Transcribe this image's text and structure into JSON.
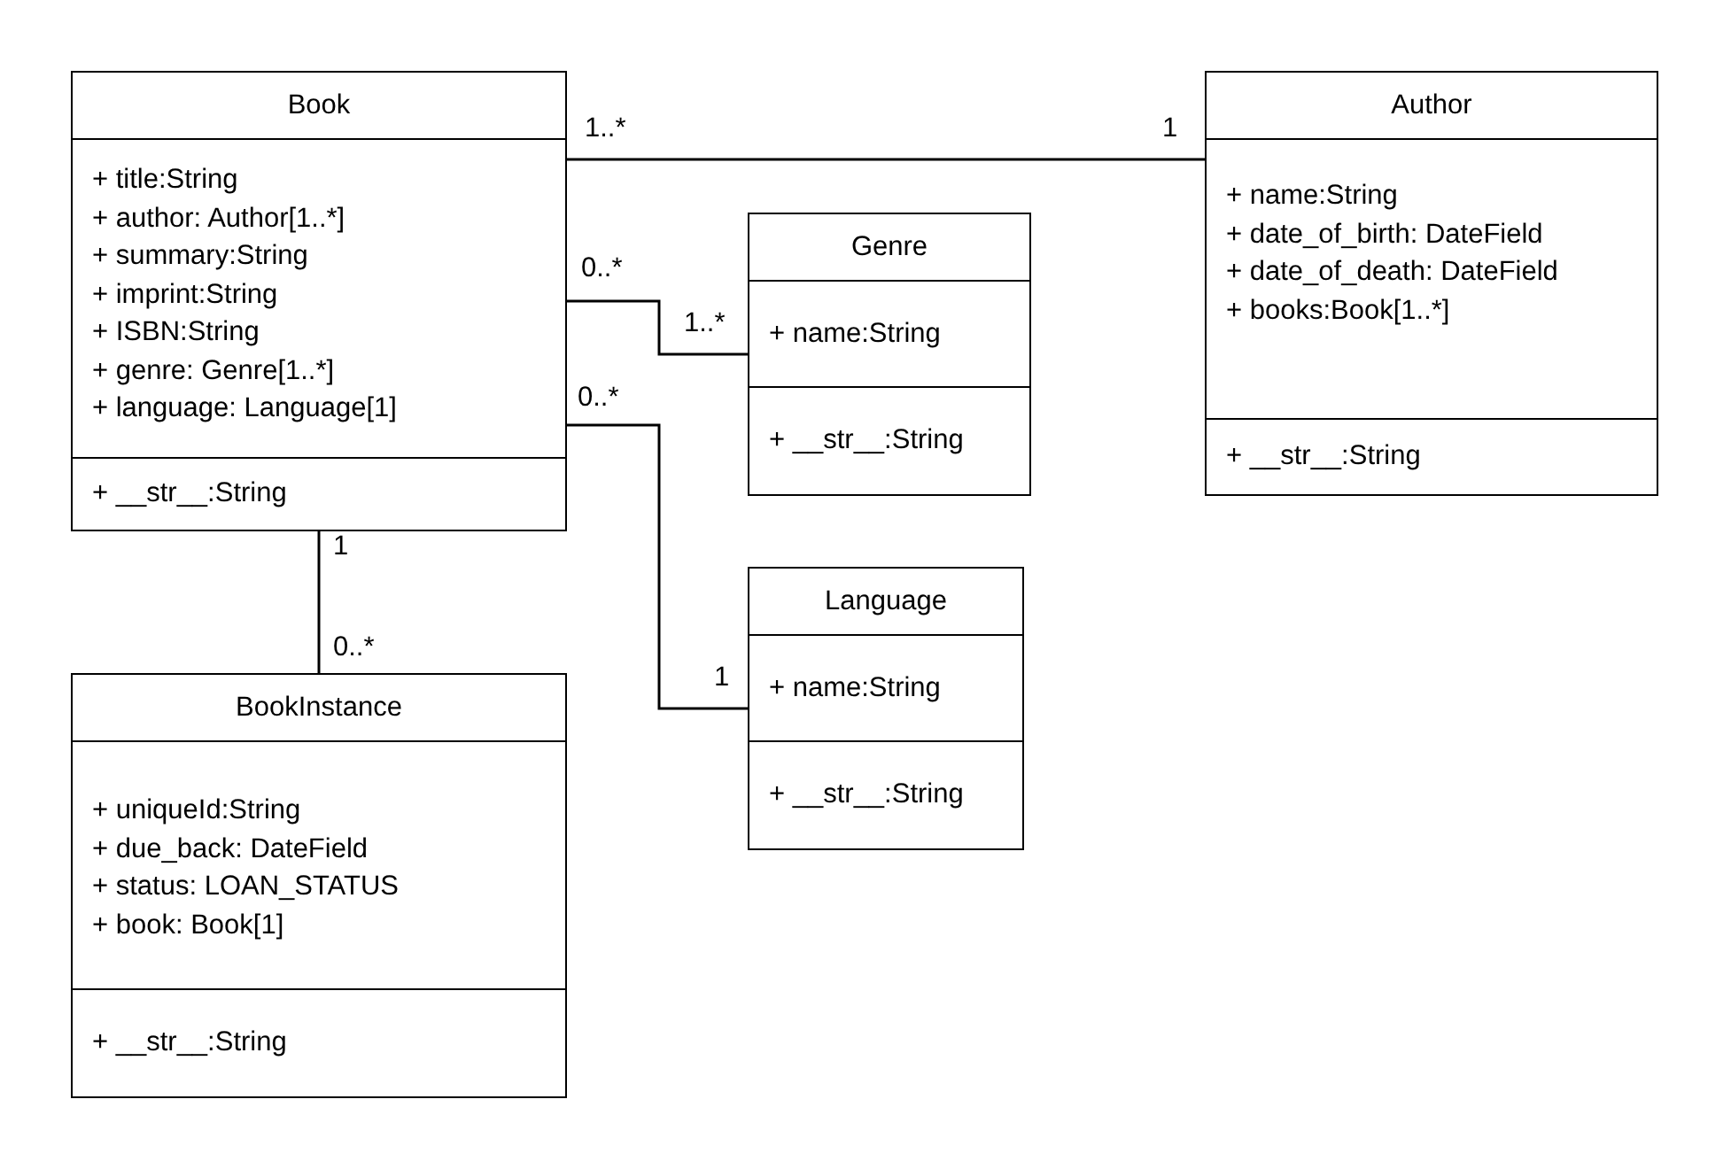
{
  "classes": [
    {
      "name": "Book",
      "attributes": [
        "+ title:String",
        "+ author: Author[1..*]",
        "+ summary:String",
        "+ imprint:String",
        "+ ISBN:String",
        "+ genre: Genre[1..*]",
        "+ language: Language[1]"
      ],
      "methods": [
        "+ __str__:String"
      ]
    },
    {
      "name": "Author",
      "attributes": [
        "+ name:String",
        "+ date_of_birth: DateField",
        "+ date_of_death: DateField",
        "+ books:Book[1..*]"
      ],
      "methods": [
        "+ __str__:String"
      ]
    },
    {
      "name": "Genre",
      "attributes": [
        "+ name:String"
      ],
      "methods": [
        "+ __str__:String"
      ]
    },
    {
      "name": "Language",
      "attributes": [
        "+ name:String"
      ],
      "methods": [
        "+ __str__:String"
      ]
    },
    {
      "name": "BookInstance",
      "attributes": [
        "+ uniqueId:String",
        "+ due_back: DateField",
        "+ status: LOAN_STATUS",
        "+ book: Book[1]"
      ],
      "methods": [
        "+ __str__:String"
      ]
    }
  ],
  "associations": [
    {
      "source_multiplicity": "1..*",
      "target_multiplicity": "1"
    },
    {
      "source_multiplicity": "0..*",
      "target_multiplicity": "1..*"
    },
    {
      "source_multiplicity": "0..*",
      "target_multiplicity": "1"
    },
    {
      "source_multiplicity": "1",
      "target_multiplicity": "0..*"
    }
  ]
}
